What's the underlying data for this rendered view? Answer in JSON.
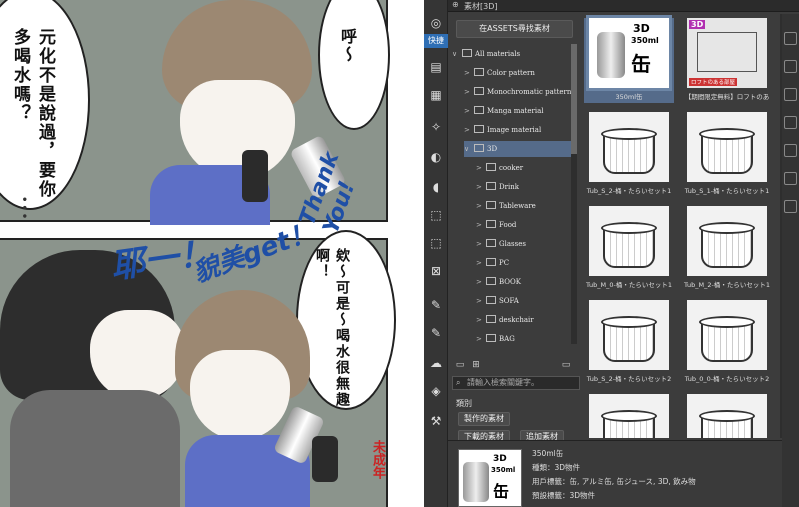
{
  "manga": {
    "top_bubble_left": "元化不是說過，要你多喝水嗎？",
    "top_bubble_right": "呼～",
    "top_dots": "•••",
    "bottom_bubble": "欸～可是～喝水很無趣啊！",
    "scribble_1": "耶一！",
    "scribble_2": "貌美get！",
    "scribble_3": "Thank You!",
    "stamp": "未成年"
  },
  "app": {
    "panel_title": "素材[3D]",
    "tool_tab": "快捷",
    "search_assets_button": "在ASSETS尋找素材",
    "tree": [
      {
        "label": "All materials",
        "indent": 0
      },
      {
        "label": "Color pattern",
        "indent": 1
      },
      {
        "label": "Monochromatic pattern",
        "indent": 1
      },
      {
        "label": "Manga material",
        "indent": 1
      },
      {
        "label": "Image material",
        "indent": 1
      },
      {
        "label": "3D",
        "indent": 1
      },
      {
        "label": "cooker",
        "indent": 2
      },
      {
        "label": "Drink",
        "indent": 2
      },
      {
        "label": "Tableware",
        "indent": 2
      },
      {
        "label": "Food",
        "indent": 2
      },
      {
        "label": "Glasses",
        "indent": 2
      },
      {
        "label": "PC",
        "indent": 2
      },
      {
        "label": "BOOK",
        "indent": 2
      },
      {
        "label": "SOFA",
        "indent": 2
      },
      {
        "label": "deskchair",
        "indent": 2
      },
      {
        "label": "BAG",
        "indent": 2
      }
    ],
    "search_placeholder": "請輸入檢索關鍵字。",
    "category_label": "類別",
    "tag_buttons": [
      "製作的素材",
      "下載的素材",
      "追加素材"
    ],
    "thumbnails": [
      {
        "caption": "350ml缶"
      },
      {
        "caption": "【期間限定無料】ロフトのあ"
      },
      {
        "caption": "Tub_S_2-桶・たらいセット1"
      },
      {
        "caption": "Tub_S_1-桶・たらいセット1"
      },
      {
        "caption": "Tub_M_0-桶・たらいセット1"
      },
      {
        "caption": "Tub_M_2-桶・たらいセット1"
      },
      {
        "caption": "Tub_S_2-桶・たらいセット2"
      },
      {
        "caption": "Tub_0_0-桶・たらいセット2"
      },
      {
        "caption": ""
      },
      {
        "caption": ""
      }
    ],
    "can_label_3d": "3D",
    "can_label_ml": "350ml",
    "can_label_kanji": "缶",
    "loft_badge": "3D",
    "loft_caption_img": "ロフトのある部屋",
    "detail": {
      "title": "350ml缶",
      "type": "種類：3D物件",
      "user_tags": "用戶標籤：缶, アルミ缶, 缶ジュース, 3D, 飲み物",
      "preset_tags": "預設標籤：3D物件"
    }
  }
}
